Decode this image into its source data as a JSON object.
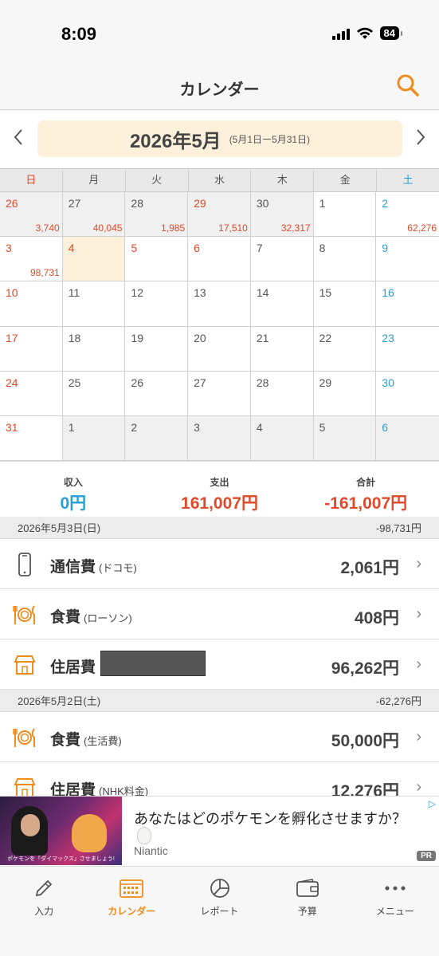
{
  "status": {
    "time": "8:09",
    "battery": "84"
  },
  "nav": {
    "title": "カレンダー"
  },
  "month": {
    "label": "2026年5月",
    "range": "(5月1日ー5月31日)",
    "prev": "‹",
    "next": "›"
  },
  "weekdays": [
    "日",
    "月",
    "火",
    "水",
    "木",
    "金",
    "土"
  ],
  "calendar": {
    "cells": [
      {
        "day": "26",
        "amount": "3,740"
      },
      {
        "day": "27",
        "amount": "40,045"
      },
      {
        "day": "28",
        "amount": "1,985"
      },
      {
        "day": "29",
        "amount": "17,510"
      },
      {
        "day": "30",
        "amount": "32,317"
      },
      {
        "day": "1",
        "amount": ""
      },
      {
        "day": "2",
        "amount": "62,276"
      },
      {
        "day": "3",
        "amount": "98,731"
      },
      {
        "day": "4",
        "amount": ""
      },
      {
        "day": "5",
        "amount": ""
      },
      {
        "day": "6",
        "amount": ""
      },
      {
        "day": "7",
        "amount": ""
      },
      {
        "day": "8",
        "amount": ""
      },
      {
        "day": "9",
        "amount": ""
      },
      {
        "day": "10",
        "amount": ""
      },
      {
        "day": "11",
        "amount": ""
      },
      {
        "day": "12",
        "amount": ""
      },
      {
        "day": "13",
        "amount": ""
      },
      {
        "day": "14",
        "amount": ""
      },
      {
        "day": "15",
        "amount": ""
      },
      {
        "day": "16",
        "amount": ""
      },
      {
        "day": "17",
        "amount": ""
      },
      {
        "day": "18",
        "amount": ""
      },
      {
        "day": "19",
        "amount": ""
      },
      {
        "day": "20",
        "amount": ""
      },
      {
        "day": "21",
        "amount": ""
      },
      {
        "day": "22",
        "amount": ""
      },
      {
        "day": "23",
        "amount": ""
      },
      {
        "day": "24",
        "amount": ""
      },
      {
        "day": "25",
        "amount": ""
      },
      {
        "day": "26",
        "amount": ""
      },
      {
        "day": "27",
        "amount": ""
      },
      {
        "day": "28",
        "amount": ""
      },
      {
        "day": "29",
        "amount": ""
      },
      {
        "day": "30",
        "amount": ""
      },
      {
        "day": "31",
        "amount": ""
      },
      {
        "day": "1",
        "amount": ""
      },
      {
        "day": "2",
        "amount": ""
      },
      {
        "day": "3",
        "amount": ""
      },
      {
        "day": "4",
        "amount": ""
      },
      {
        "day": "5",
        "amount": ""
      },
      {
        "day": "6",
        "amount": ""
      }
    ]
  },
  "summary": {
    "income_label": "収入",
    "income": "0円",
    "expense_label": "支出",
    "expense": "161,007円",
    "total_label": "合計",
    "total": "-161,007円"
  },
  "days": [
    {
      "date": "2026年5月3日(日)",
      "total": "-98,731円",
      "entries": [
        {
          "category": "通信費",
          "memo": "(ドコモ)",
          "amount": "2,061円",
          "icon": "phone-icon"
        },
        {
          "category": "食費",
          "memo": "(ローソン)",
          "amount": "408円",
          "icon": "food-icon"
        },
        {
          "category": "住居費",
          "memo": "",
          "amount": "96,262円",
          "icon": "house-icon"
        }
      ]
    },
    {
      "date": "2026年5月2日(土)",
      "total": "-62,276円",
      "entries": [
        {
          "category": "食費",
          "memo": "(生活費)",
          "amount": "50,000円",
          "icon": "food-icon"
        },
        {
          "category": "住居費",
          "memo": "(NHK料金)",
          "amount": "12,276円",
          "icon": "house-icon"
        }
      ]
    }
  ],
  "ad": {
    "title": "あなたはどのポケモンを孵化させますか？",
    "brand": "Niantic",
    "badge": "PR",
    "image_caption": "ポケモンを「ダイマックス」させましょう!"
  },
  "tabs": [
    {
      "label": "入力",
      "icon": "pencil-icon"
    },
    {
      "label": "カレンダー",
      "icon": "calendar-icon"
    },
    {
      "label": "レポート",
      "icon": "pie-chart-icon"
    },
    {
      "label": "予算",
      "icon": "wallet-icon"
    },
    {
      "label": "メニュー",
      "icon": "more-icon"
    }
  ],
  "colors": {
    "accent": "#f08c1e",
    "expense": "#e04a2a",
    "income": "#2a9fd6",
    "today_bg": "#fdf1dc",
    "other_month_bg": "#f0f0f0"
  }
}
